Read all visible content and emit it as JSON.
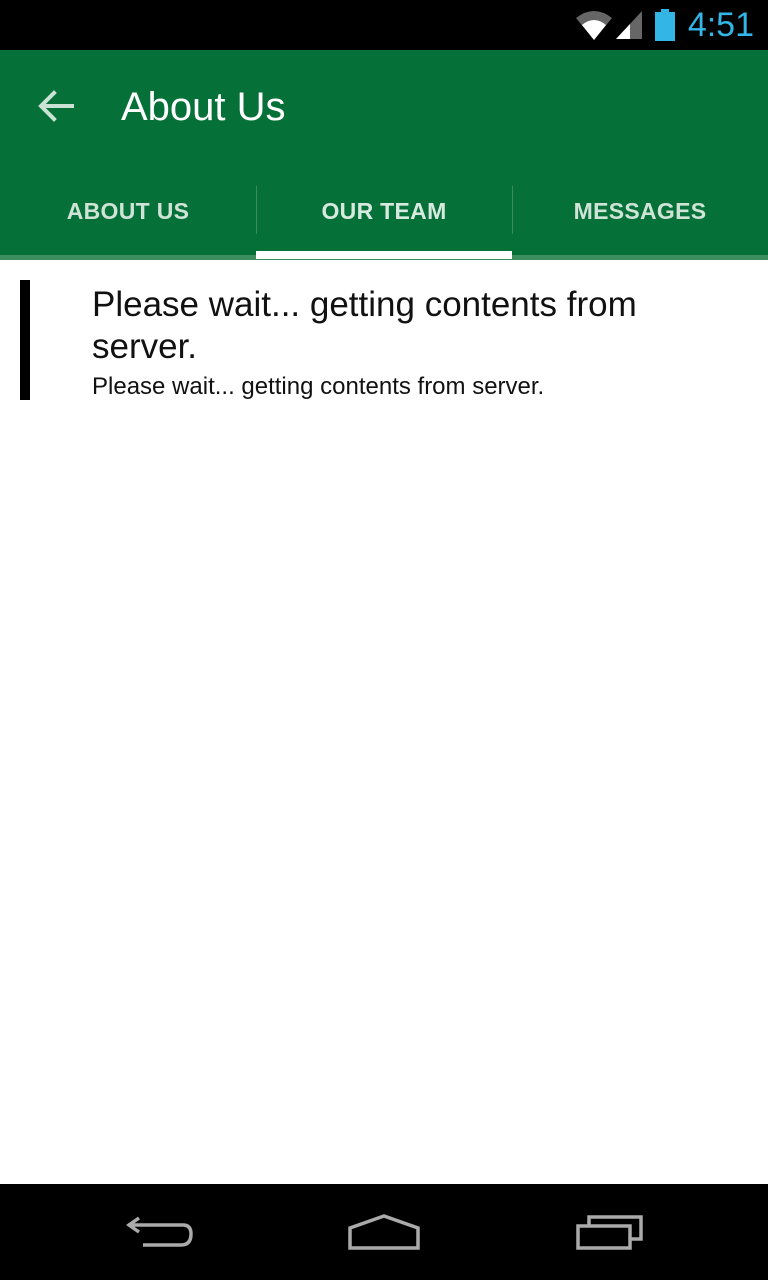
{
  "status_bar": {
    "time": "4:51",
    "icons": [
      "wifi-icon",
      "signal-icon",
      "battery-icon"
    ],
    "time_color": "#33b5e5"
  },
  "app_bar": {
    "title": "About Us",
    "back_icon": "arrow-back-icon",
    "background": "#057037"
  },
  "tabs": [
    {
      "label": "ABOUT US",
      "active": false
    },
    {
      "label": "OUR TEAM",
      "active": true
    },
    {
      "label": "MESSAGES",
      "active": false
    }
  ],
  "content": {
    "title": "Please wait... getting contents from server.",
    "body": "Please wait... getting contents from server."
  },
  "nav_bar": {
    "buttons": [
      "back-nav-icon",
      "home-nav-icon",
      "recents-nav-icon"
    ]
  }
}
